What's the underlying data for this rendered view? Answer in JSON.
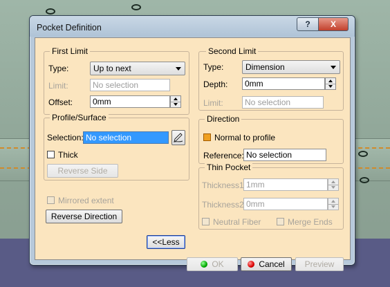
{
  "window": {
    "title": "Pocket Definition",
    "help": "?",
    "close": "X"
  },
  "first_limit": {
    "title": "First Limit",
    "type_label": "Type:",
    "type_value": "Up to next",
    "limit_label": "Limit:",
    "limit_value": "No selection",
    "offset_label": "Offset:",
    "offset_value": "0mm"
  },
  "profile": {
    "title": "Profile/Surface",
    "selection_label": "Selection:",
    "selection_value": "No selection",
    "thick_label": "Thick",
    "reverse_side": "Reverse Side"
  },
  "mirrored_extent": "Mirrored extent",
  "reverse_direction": "Reverse Direction",
  "second_limit": {
    "title": "Second Limit",
    "type_label": "Type:",
    "type_value": "Dimension",
    "depth_label": "Depth:",
    "depth_value": "0mm",
    "limit_label": "Limit:",
    "limit_value": "No selection"
  },
  "direction": {
    "title": "Direction",
    "normal_label": "Normal to profile",
    "reference_label": "Reference:",
    "reference_value": "No selection"
  },
  "thin_pocket": {
    "title": "Thin Pocket",
    "thickness1_label": "Thickness1",
    "thickness1_value": "1mm",
    "thickness2_label": "Thickness2:",
    "thickness2_value": "0mm",
    "neutral_fiber": "Neutral Fiber",
    "merge_ends": "Merge Ends"
  },
  "footer": {
    "less": "<<Less",
    "ok": "OK",
    "cancel": "Cancel",
    "preview": "Preview"
  },
  "colors": {
    "dialog_bg": "#fbe5bf",
    "selection_blue": "#3399ff",
    "accent_orange": "#f0a020"
  },
  "icons": [
    "help-icon",
    "close-icon",
    "dropdown-arrow-icon",
    "spinner-icon",
    "edit-sketch-icon",
    "ok-icon",
    "cancel-icon"
  ]
}
